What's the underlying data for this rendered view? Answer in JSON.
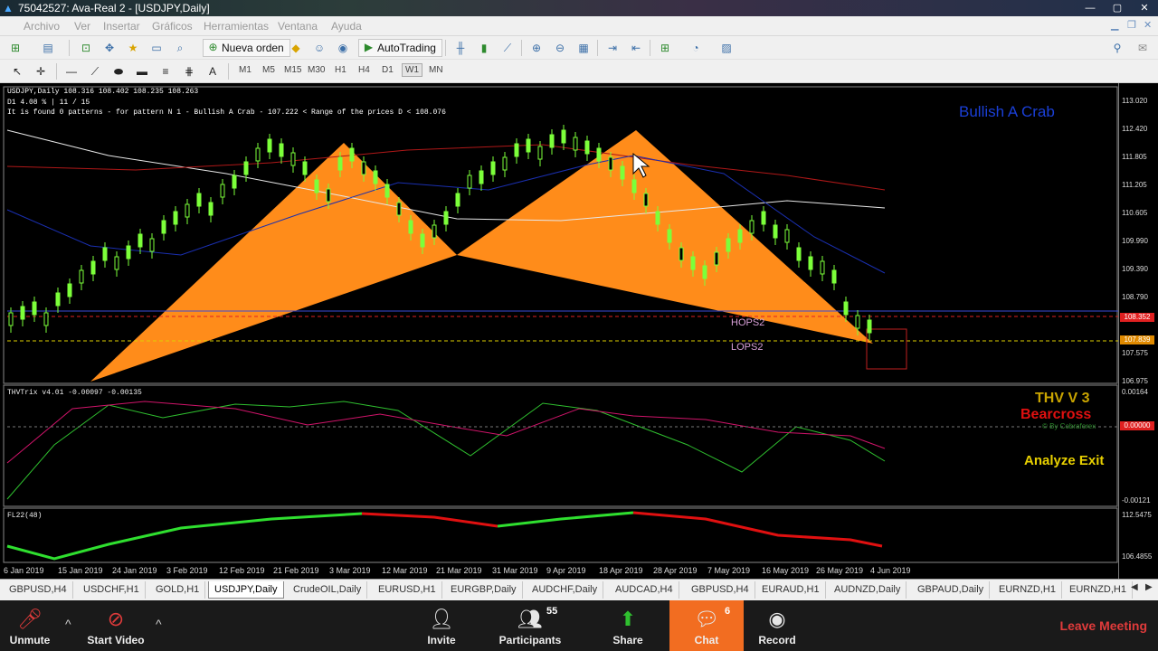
{
  "window": {
    "title": "75042527: Ava-Real 2 - [USDJPY,Daily]",
    "controls": [
      "—",
      "▢",
      "✕"
    ]
  },
  "menu": [
    "Archivo",
    "Ver",
    "Insertar",
    "Gráficos",
    "Herramientas",
    "Ventana",
    "Ayuda"
  ],
  "toolbar": {
    "new_order": "Nueva orden",
    "autotrading": "AutoTrading",
    "timeframes": [
      "M1",
      "M5",
      "M15",
      "M30",
      "H1",
      "H4",
      "D1",
      "W1",
      "MN"
    ],
    "active_timeframe": "D1"
  },
  "chart": {
    "symbol_info": "USDJPY,Daily  108.316 108.402 108.235 108.263",
    "line2": "D1   4.08 % | 11 / 15",
    "line3": "It is found 0 patterns  -  for pattern N 1 - Bullish A Crab  - 107.222 < Range of the prices D < 108.076",
    "pattern_title": "Bullish A Crab",
    "labels": {
      "hops": "HOPS2",
      "lops": "LOPS2"
    },
    "price_axis": [
      "113.020",
      "112.420",
      "111.805",
      "111.205",
      "110.605",
      "109.990",
      "109.390",
      "108.790",
      "107.575",
      "106.975"
    ],
    "price_tags": {
      "current": "108.352",
      "secondary": "107.839"
    },
    "indicator1": {
      "name": "THVTrix v4.01 -0.00097 -0.00135",
      "axis": [
        "0.00164",
        "0.00000",
        "-0.00121"
      ],
      "title": "THV V 3",
      "signal": "Bearcross",
      "credit": "© By Cobraforex",
      "action": "Analyze Exit"
    },
    "indicator2": {
      "name": "FL22(48)",
      "axis": [
        "112.5475",
        "106.4855"
      ]
    },
    "dates": [
      "6 Jan 2019",
      "15 Jan 2019",
      "24 Jan 2019",
      "3 Feb 2019",
      "12 Feb 2019",
      "21 Feb 2019",
      "3 Mar 2019",
      "12 Mar 2019",
      "21 Mar 2019",
      "31 Mar 2019",
      "9 Apr 2019",
      "18 Apr 2019",
      "28 Apr 2019",
      "7 May 2019",
      "16 May 2019",
      "26 May 2019",
      "4 Jun 2019"
    ]
  },
  "tabs": [
    "GBPUSD,H4",
    "USDCHF,H1",
    "GOLD,H1",
    "USDJPY,Daily",
    "CrudeOIL,Daily",
    "EURUSD,H1",
    "EURGBP,Daily",
    "AUDCHF,Daily",
    "AUDCAD,H4",
    "GBPUSD,H4",
    "EURAUD,H1",
    "AUDNZD,Daily",
    "GBPAUD,Daily",
    "EURNZD,H1",
    "EURNZD,H1"
  ],
  "active_tab": "USDJPY,Daily",
  "zoom": {
    "unmute": "Unmute",
    "start_video": "Start Video",
    "invite": "Invite",
    "participants": "Participants",
    "participants_count": "55",
    "share": "Share",
    "chat": "Chat",
    "chat_count": "6",
    "record": "Record",
    "leave": "Leave Meeting"
  }
}
